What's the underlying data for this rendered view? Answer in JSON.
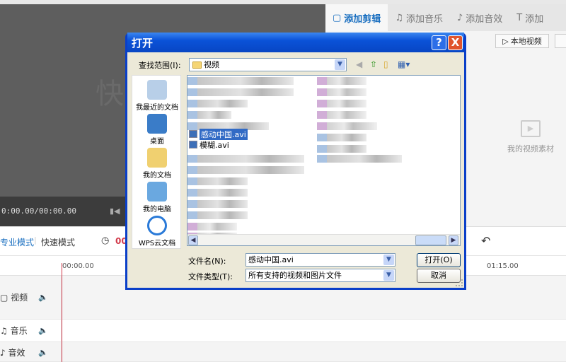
{
  "preview": {
    "watermark": "快",
    "time": "0:00.00/00:00.00"
  },
  "tabs": [
    {
      "label": "添加剪辑",
      "icon": "video-icon",
      "active": true
    },
    {
      "label": "添加音乐",
      "icon": "music-icon"
    },
    {
      "label": "添加音效",
      "icon": "sound-effect-icon"
    },
    {
      "label": "添加",
      "icon": "text-icon"
    }
  ],
  "right_panel": {
    "local_video": "本地视频",
    "my_material": "我的视频素材"
  },
  "toolbar": {
    "pro_mode": "专业模式",
    "fast_mode": "快速模式",
    "time_partial": "00"
  },
  "ruler": {
    "start": "00:00.00",
    "mark": "01:15.00"
  },
  "tracks": [
    {
      "label": "视频",
      "icon": "video-icon"
    },
    {
      "label": "音乐",
      "icon": "music-icon"
    },
    {
      "label": "音效",
      "icon": "sound-effect-icon"
    }
  ],
  "dialog": {
    "title": "打开",
    "help": "?",
    "close": "X",
    "look_in_label": "查找范围(I):",
    "look_in_value": "视频",
    "places": [
      "我最近的文档",
      "桌面",
      "我的文档",
      "我的电脑",
      "WPS云文档"
    ],
    "files": [
      {
        "name": "感动中国.avi",
        "selected": true
      },
      {
        "name": "模糊.avi",
        "selected": false
      }
    ],
    "filename_label": "文件名(N):",
    "filename_value": "感动中国.avi",
    "filetype_label": "文件类型(T):",
    "filetype_value": "所有支持的视频和图片文件",
    "open_button": "打开(O)",
    "cancel_button": "取消"
  },
  "colors": {
    "accent": "#1a6fc0",
    "playhead": "#d23a4a",
    "xp_title": "#0a52d8",
    "selection": "#316ac5"
  }
}
